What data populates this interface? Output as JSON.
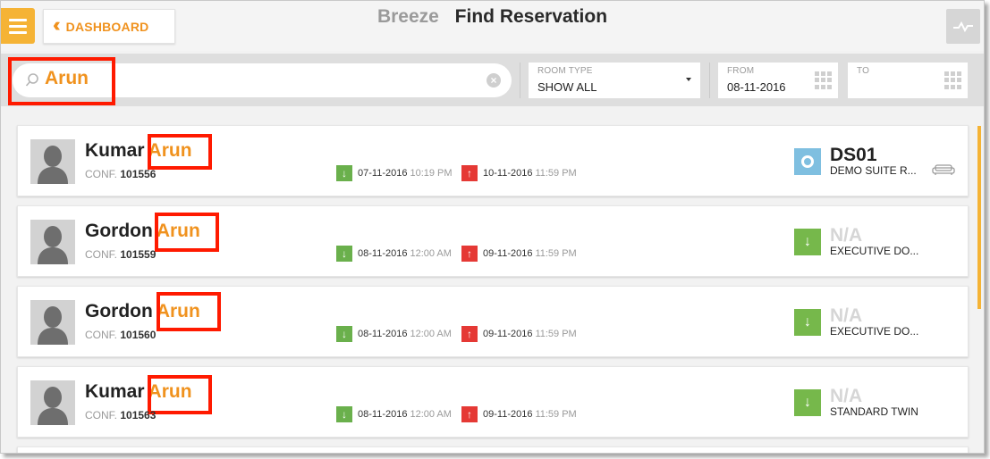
{
  "header": {
    "dashboard_label": "DASHBOARD",
    "brand": "Breeze",
    "title": "Find Reservation",
    "menu_icon": "hamburger-icon",
    "activity_icon": "pulse-icon"
  },
  "filters": {
    "search_value": "Arun",
    "room_type": {
      "label": "ROOM TYPE",
      "value": "SHOW ALL"
    },
    "from": {
      "label": "FROM",
      "value": "08-11-2016"
    },
    "to": {
      "label": "TO",
      "value": ""
    }
  },
  "reservations": [
    {
      "last_name": "Kumar",
      "first_name": "Arun",
      "conf_label": "CONF.",
      "conf": "101556",
      "arrival_date": "07-11-2016",
      "arrival_time": "10:19 PM",
      "departure_date": "10-11-2016",
      "departure_time": "11:59 PM",
      "room_no": "DS01",
      "room_type": "DEMO SUITE R...",
      "status": "in-house"
    },
    {
      "last_name": "Gordon",
      "first_name": "Arun",
      "conf_label": "CONF.",
      "conf": "101559",
      "arrival_date": "08-11-2016",
      "arrival_time": "12:00 AM",
      "departure_date": "09-11-2016",
      "departure_time": "11:59 PM",
      "room_no": "N/A",
      "room_type": "EXECUTIVE DO...",
      "status": "arriving"
    },
    {
      "last_name": "Gordon",
      "first_name": "Arun",
      "conf_label": "CONF.",
      "conf": "101560",
      "arrival_date": "08-11-2016",
      "arrival_time": "12:00 AM",
      "departure_date": "09-11-2016",
      "departure_time": "11:59 PM",
      "room_no": "N/A",
      "room_type": "EXECUTIVE DO...",
      "status": "arriving"
    },
    {
      "last_name": "Kumar",
      "first_name": "Arun",
      "conf_label": "CONF.",
      "conf": "101563",
      "arrival_date": "08-11-2016",
      "arrival_time": "12:00 AM",
      "departure_date": "09-11-2016",
      "departure_time": "11:59 PM",
      "room_no": "N/A",
      "room_type": "STANDARD TWIN",
      "status": "arriving"
    }
  ],
  "colors": {
    "accent": "#f0921e",
    "menu": "#f5b335",
    "highlight": "#ff1a00",
    "arrival": "#6ab04c",
    "departure": "#e53935",
    "in_house": "#7fbfe0"
  }
}
